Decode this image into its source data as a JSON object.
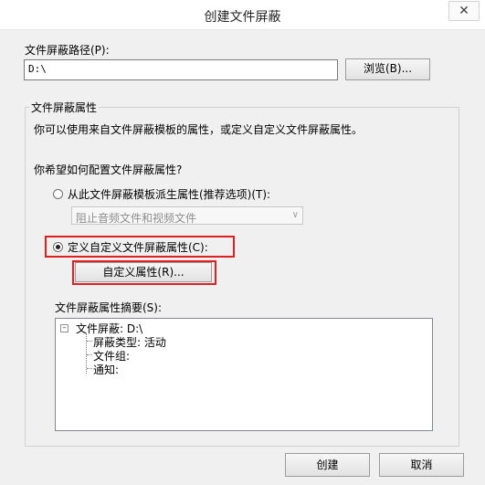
{
  "window": {
    "title": "创建文件屏蔽",
    "close_glyph": "✕"
  },
  "path": {
    "label": "文件屏蔽路径(P):",
    "value": "D:\\",
    "browse_label": "浏览(B)..."
  },
  "properties": {
    "group_title": "文件屏蔽属性",
    "description": "你可以使用来自文件屏蔽模板的属性，或定义自定义文件屏蔽属性。",
    "question": "你希望如何配置文件屏蔽属性?",
    "option_template": "从此文件屏蔽模板派生属性(推荐选项)(T):",
    "template_select_value": "阻止音频文件和视频文件",
    "option_custom": "定义自定义文件屏蔽属性(C):",
    "custom_button_label": "自定义属性(R)...",
    "summary_label": "文件屏蔽属性摘要(S):",
    "summary_tree": {
      "root": "文件屏蔽: D:\\",
      "children": [
        "屏蔽类型: 活动",
        "文件组:",
        "通知:"
      ]
    }
  },
  "footer": {
    "create_label": "创建",
    "cancel_label": "取消"
  },
  "state": {
    "selected_option": "custom"
  },
  "colors": {
    "highlight": "#e02020"
  }
}
